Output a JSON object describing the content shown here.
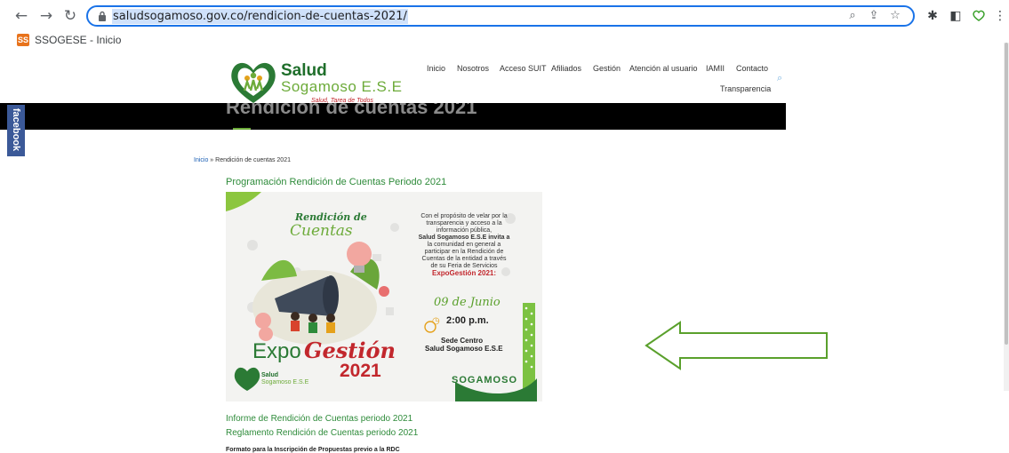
{
  "browser": {
    "url": "saludsogamoso.gov.co/rendicion-de-cuentas-2021/",
    "bookmark_label": "SSOGESE - Inicio",
    "bookmark_favicon": "SS"
  },
  "site": {
    "logo_title": "Salud",
    "logo_subtitle": "Sogamoso E.S.E",
    "logo_tagline": "Salud, Tarea de Todos",
    "menu": [
      "Inicio",
      "Nosotros",
      "Acceso SUIT",
      "Afiliados",
      "Gestión",
      "Atención al usuario",
      "IAMII",
      "Contacto",
      "Transparencia"
    ],
    "facebook_tab": "facebook"
  },
  "page": {
    "banner_title": "Rendición de cuentas 2021",
    "breadcrumb_home": "Inicio",
    "breadcrumb_sep": " » ",
    "breadcrumb_current": "Rendición de cuentas 2021",
    "section_title": "Programación Rendición de Cuentas Periodo 2021",
    "links": [
      "Informe de Rendición de Cuentas  periodo 2021",
      "Reglamento Rendición de Cuentas  periodo 2021"
    ],
    "bold_text": "Formato para la Inscripción de Propuestas previo a la RDC"
  },
  "poster": {
    "heading_line1": "Rendición de",
    "heading_line2": "Cuentas",
    "intro": [
      "Con el propósito de velar por la",
      "transparencia y acceso a la",
      "información pública,"
    ],
    "entity": "Salud Sogamoso E.S.E invita a",
    "invite": [
      "la comunidad en general a",
      "participar en la Rendición de",
      "Cuentas de la entidad a través",
      "de su Feria de Servicios"
    ],
    "event": "ExpoGestión 2021:",
    "date": "09 de Junio",
    "time": "2:00 p.m.",
    "venue_line1": "Sede Centro",
    "venue_line2": "Salud Sogamoso E.S.E",
    "brand_expo": "Expo",
    "brand_gestion": "Gestión",
    "brand_year": "2021",
    "footer_logo": "SOGAMOSO",
    "small_logo_title": "Salud",
    "small_logo_sub": "Sogamoso E.S.E"
  },
  "colors": {
    "accent_green": "#2e8b3a",
    "omnibox_blue": "#1a73e8",
    "arrow_green": "#5aa02c",
    "facebook_blue": "#3b5998"
  }
}
